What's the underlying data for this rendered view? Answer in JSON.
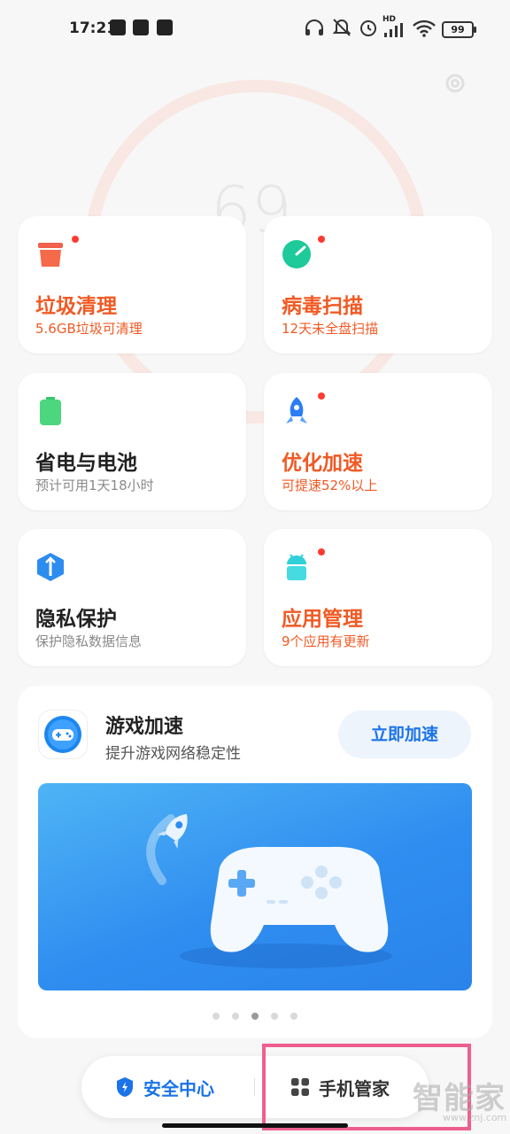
{
  "status_bar": {
    "time": "17:21",
    "hd_label": "HD",
    "battery": "99"
  },
  "background": {
    "score": "69"
  },
  "tiles": [
    {
      "title": "垃圾清理",
      "sub": "5.6GB垃圾可清理",
      "icon": "trash-icon",
      "color": "#f56a4b",
      "badge": true
    },
    {
      "title": "病毒扫描",
      "sub": "12天未全盘扫描",
      "icon": "virus-scan-icon",
      "color": "#1ec99a",
      "badge": true
    },
    {
      "title": "省电与电池",
      "sub": "预计可用1天18小时",
      "icon": "battery-icon",
      "color": "#35c76a",
      "badge": false
    },
    {
      "title": "优化加速",
      "sub": "可提速52%以上",
      "icon": "rocket-icon",
      "color": "#2a7df4",
      "badge": true
    },
    {
      "title": "隐私保护",
      "sub": "保护隐私数据信息",
      "icon": "privacy-shield-icon",
      "color": "#2d8cf0",
      "badge": false
    },
    {
      "title": "应用管理",
      "sub": "9个应用有更新",
      "icon": "android-app-icon",
      "color": "#2fd0d8",
      "badge": true
    }
  ],
  "game_card": {
    "title": "游戏加速",
    "subtitle": "提升游戏网络稳定性",
    "button": "立即加速",
    "carousel_active_index": 2,
    "carousel_count": 5
  },
  "tab_bar": {
    "security_center": "安全中心",
    "phone_manager": "手机管家"
  },
  "watermark": {
    "text": "智能家",
    "url": "www.znj.com"
  },
  "colors": {
    "warning": "#f05a24",
    "accent": "#1a73e8",
    "highlight_border": "#ef5f8e"
  }
}
